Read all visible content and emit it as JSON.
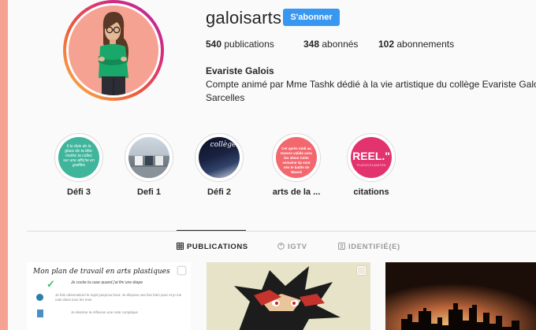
{
  "profile": {
    "username": "galoisarts",
    "follow_label": "S'abonner",
    "stats": {
      "posts_count": "540",
      "posts_label": "publications",
      "followers_count": "348",
      "followers_label": "abonnés",
      "following_count": "102",
      "following_label": "abonnements"
    },
    "full_name": "Evariste Galois",
    "bio_line1": "Compte animé par Mme Tashk dédié à la vie artistique du collège Evariste Galois",
    "bio_line2": "Sarcelles"
  },
  "highlights": [
    {
      "label": "Défi 3",
      "cover_text": "Il tu dois de la glace de ta tête: mettre ta collec sur une affiche en graffitis"
    },
    {
      "label": "Defi 1"
    },
    {
      "label": "Défi 2",
      "cover_text": "collège"
    },
    {
      "label": "arts de la ...",
      "cover_text": "Cet après midi au travers valide avec les 3ème Cette semaine #p sont nés le battle de Wasck"
    },
    {
      "label": "citations",
      "cover_text": "REEL.\"",
      "cover_subtext": "PLATUS ELVASTEN"
    }
  ],
  "tabs": [
    {
      "label": "PUBLICATIONS",
      "icon": "grid-icon",
      "active": true
    },
    {
      "label": "IGTV",
      "icon": "igtv-icon",
      "active": false
    },
    {
      "label": "IDENTIFIÉ(E)",
      "icon": "tagged-icon",
      "active": false
    }
  ],
  "posts": [
    {
      "title": "Mon plan de travail en arts plastiques",
      "line1": "Je cocke la case quand j'ai fini une étape",
      "line2": "Je fais observation/ le sujet jusqu'au bout: Je dispose une lise bien pour et je me note dans tous les trois",
      "line3": "Je dessine la réflexion une note complique"
    },
    {
      "alt": "drawing"
    },
    {
      "alt": "city skyline"
    }
  ],
  "colors": {
    "accent": "#3897f0",
    "page_background": "#f6a293",
    "card_background": "#fafafa"
  }
}
